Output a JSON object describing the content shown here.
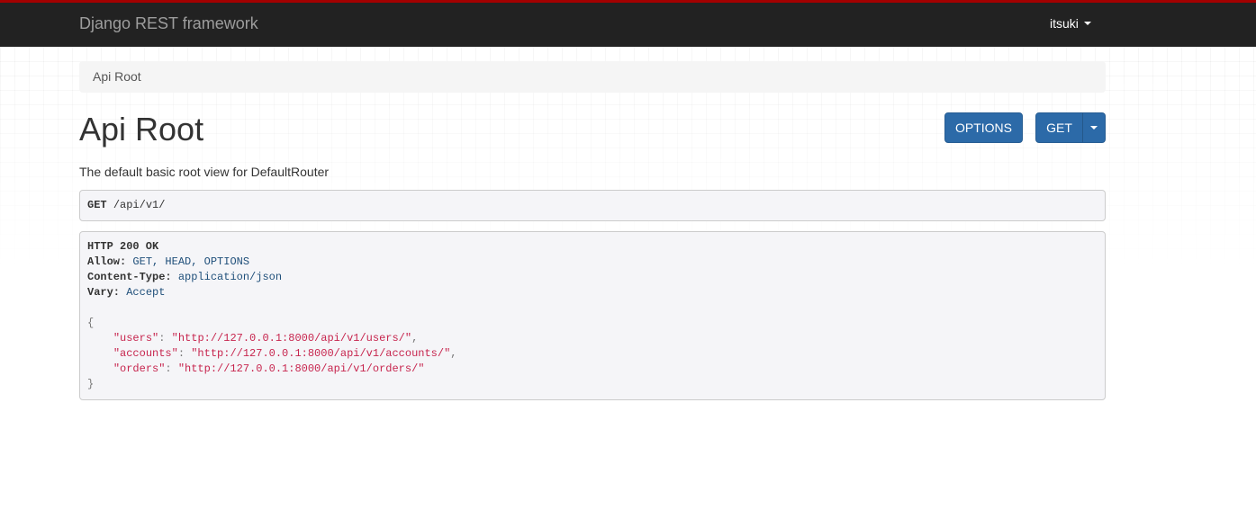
{
  "navbar": {
    "brand": "Django REST framework",
    "user": "itsuki"
  },
  "breadcrumb": {
    "items": [
      "Api Root"
    ]
  },
  "page": {
    "title": "Api Root",
    "description": "The default basic root view for DefaultRouter"
  },
  "buttons": {
    "options_label": "OPTIONS",
    "get_label": "GET"
  },
  "request": {
    "method": "GET",
    "path": "/api/v1/"
  },
  "response": {
    "status": "HTTP 200 OK",
    "headers": [
      {
        "name": "Allow:",
        "value": "GET, HEAD, OPTIONS"
      },
      {
        "name": "Content-Type:",
        "value": "application/json"
      },
      {
        "name": "Vary:",
        "value": "Accept"
      }
    ],
    "body": [
      {
        "key": "\"users\"",
        "value": "\"http://127.0.0.1:8000/api/v1/users/\"",
        "sep": ","
      },
      {
        "key": "\"accounts\"",
        "value": "\"http://127.0.0.1:8000/api/v1/accounts/\"",
        "sep": ","
      },
      {
        "key": "\"orders\"",
        "value": "\"http://127.0.0.1:8000/api/v1/orders/\"",
        "sep": ""
      }
    ]
  },
  "colors": {
    "navbar_bg": "#222222",
    "navbar_accent": "#a30000",
    "button_primary": "#2c6aa8",
    "string_color": "#c7254e"
  }
}
